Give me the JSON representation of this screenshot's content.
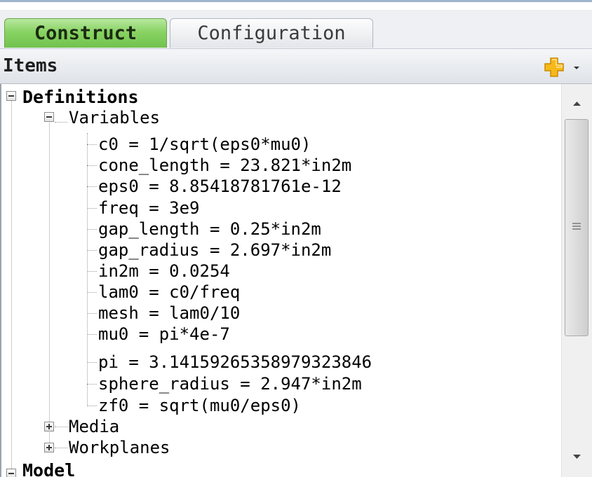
{
  "tabs": {
    "construct": "Construct",
    "configuration": "Configuration"
  },
  "items_header": {
    "title": "Items"
  },
  "tree": {
    "definitions": "Definitions",
    "variables": "Variables",
    "variable_items": [
      "c0 = 1/sqrt(eps0*mu0)",
      "cone_length = 23.821*in2m",
      "eps0 = 8.85418781761e-12",
      "freq = 3e9",
      "gap_length = 0.25*in2m",
      "gap_radius = 2.697*in2m",
      "in2m = 0.0254",
      "lam0 = c0/freq",
      "mesh = lam0/10",
      "mu0 = pi*4e-7",
      "pi = 3.14159265358979323846",
      "sphere_radius = 2.947*in2m",
      "zf0 = sqrt(mu0/eps0)"
    ],
    "media": "Media",
    "workplanes": "Workplanes",
    "model": "Model"
  },
  "colors": {
    "active_tab": "#88d363",
    "add_icon": "#f2a900",
    "tree_lines": "#9a9a9a"
  },
  "icons": {
    "add": "plus-icon",
    "dropdown": "chevron-down-icon",
    "collapse": "minus-box-icon",
    "expand": "plus-box-icon",
    "scroll_up": "arrow-up-icon",
    "scroll_down": "arrow-down-icon",
    "grip": "grip-icon"
  }
}
